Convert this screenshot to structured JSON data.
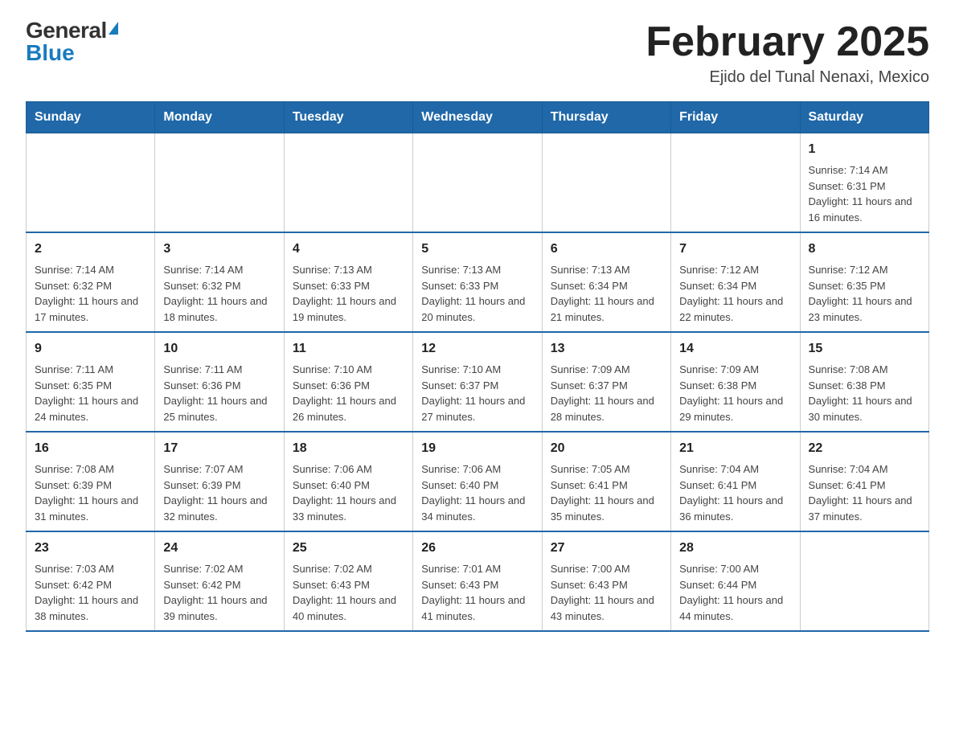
{
  "header": {
    "logo_general": "General",
    "logo_blue": "Blue",
    "month_title": "February 2025",
    "location": "Ejido del Tunal Nenaxi, Mexico"
  },
  "weekdays": [
    "Sunday",
    "Monday",
    "Tuesday",
    "Wednesday",
    "Thursday",
    "Friday",
    "Saturday"
  ],
  "weeks": [
    [
      {
        "day": "",
        "info": ""
      },
      {
        "day": "",
        "info": ""
      },
      {
        "day": "",
        "info": ""
      },
      {
        "day": "",
        "info": ""
      },
      {
        "day": "",
        "info": ""
      },
      {
        "day": "",
        "info": ""
      },
      {
        "day": "1",
        "info": "Sunrise: 7:14 AM\nSunset: 6:31 PM\nDaylight: 11 hours and 16 minutes."
      }
    ],
    [
      {
        "day": "2",
        "info": "Sunrise: 7:14 AM\nSunset: 6:32 PM\nDaylight: 11 hours and 17 minutes."
      },
      {
        "day": "3",
        "info": "Sunrise: 7:14 AM\nSunset: 6:32 PM\nDaylight: 11 hours and 18 minutes."
      },
      {
        "day": "4",
        "info": "Sunrise: 7:13 AM\nSunset: 6:33 PM\nDaylight: 11 hours and 19 minutes."
      },
      {
        "day": "5",
        "info": "Sunrise: 7:13 AM\nSunset: 6:33 PM\nDaylight: 11 hours and 20 minutes."
      },
      {
        "day": "6",
        "info": "Sunrise: 7:13 AM\nSunset: 6:34 PM\nDaylight: 11 hours and 21 minutes."
      },
      {
        "day": "7",
        "info": "Sunrise: 7:12 AM\nSunset: 6:34 PM\nDaylight: 11 hours and 22 minutes."
      },
      {
        "day": "8",
        "info": "Sunrise: 7:12 AM\nSunset: 6:35 PM\nDaylight: 11 hours and 23 minutes."
      }
    ],
    [
      {
        "day": "9",
        "info": "Sunrise: 7:11 AM\nSunset: 6:35 PM\nDaylight: 11 hours and 24 minutes."
      },
      {
        "day": "10",
        "info": "Sunrise: 7:11 AM\nSunset: 6:36 PM\nDaylight: 11 hours and 25 minutes."
      },
      {
        "day": "11",
        "info": "Sunrise: 7:10 AM\nSunset: 6:36 PM\nDaylight: 11 hours and 26 minutes."
      },
      {
        "day": "12",
        "info": "Sunrise: 7:10 AM\nSunset: 6:37 PM\nDaylight: 11 hours and 27 minutes."
      },
      {
        "day": "13",
        "info": "Sunrise: 7:09 AM\nSunset: 6:37 PM\nDaylight: 11 hours and 28 minutes."
      },
      {
        "day": "14",
        "info": "Sunrise: 7:09 AM\nSunset: 6:38 PM\nDaylight: 11 hours and 29 minutes."
      },
      {
        "day": "15",
        "info": "Sunrise: 7:08 AM\nSunset: 6:38 PM\nDaylight: 11 hours and 30 minutes."
      }
    ],
    [
      {
        "day": "16",
        "info": "Sunrise: 7:08 AM\nSunset: 6:39 PM\nDaylight: 11 hours and 31 minutes."
      },
      {
        "day": "17",
        "info": "Sunrise: 7:07 AM\nSunset: 6:39 PM\nDaylight: 11 hours and 32 minutes."
      },
      {
        "day": "18",
        "info": "Sunrise: 7:06 AM\nSunset: 6:40 PM\nDaylight: 11 hours and 33 minutes."
      },
      {
        "day": "19",
        "info": "Sunrise: 7:06 AM\nSunset: 6:40 PM\nDaylight: 11 hours and 34 minutes."
      },
      {
        "day": "20",
        "info": "Sunrise: 7:05 AM\nSunset: 6:41 PM\nDaylight: 11 hours and 35 minutes."
      },
      {
        "day": "21",
        "info": "Sunrise: 7:04 AM\nSunset: 6:41 PM\nDaylight: 11 hours and 36 minutes."
      },
      {
        "day": "22",
        "info": "Sunrise: 7:04 AM\nSunset: 6:41 PM\nDaylight: 11 hours and 37 minutes."
      }
    ],
    [
      {
        "day": "23",
        "info": "Sunrise: 7:03 AM\nSunset: 6:42 PM\nDaylight: 11 hours and 38 minutes."
      },
      {
        "day": "24",
        "info": "Sunrise: 7:02 AM\nSunset: 6:42 PM\nDaylight: 11 hours and 39 minutes."
      },
      {
        "day": "25",
        "info": "Sunrise: 7:02 AM\nSunset: 6:43 PM\nDaylight: 11 hours and 40 minutes."
      },
      {
        "day": "26",
        "info": "Sunrise: 7:01 AM\nSunset: 6:43 PM\nDaylight: 11 hours and 41 minutes."
      },
      {
        "day": "27",
        "info": "Sunrise: 7:00 AM\nSunset: 6:43 PM\nDaylight: 11 hours and 43 minutes."
      },
      {
        "day": "28",
        "info": "Sunrise: 7:00 AM\nSunset: 6:44 PM\nDaylight: 11 hours and 44 minutes."
      },
      {
        "day": "",
        "info": ""
      }
    ]
  ]
}
